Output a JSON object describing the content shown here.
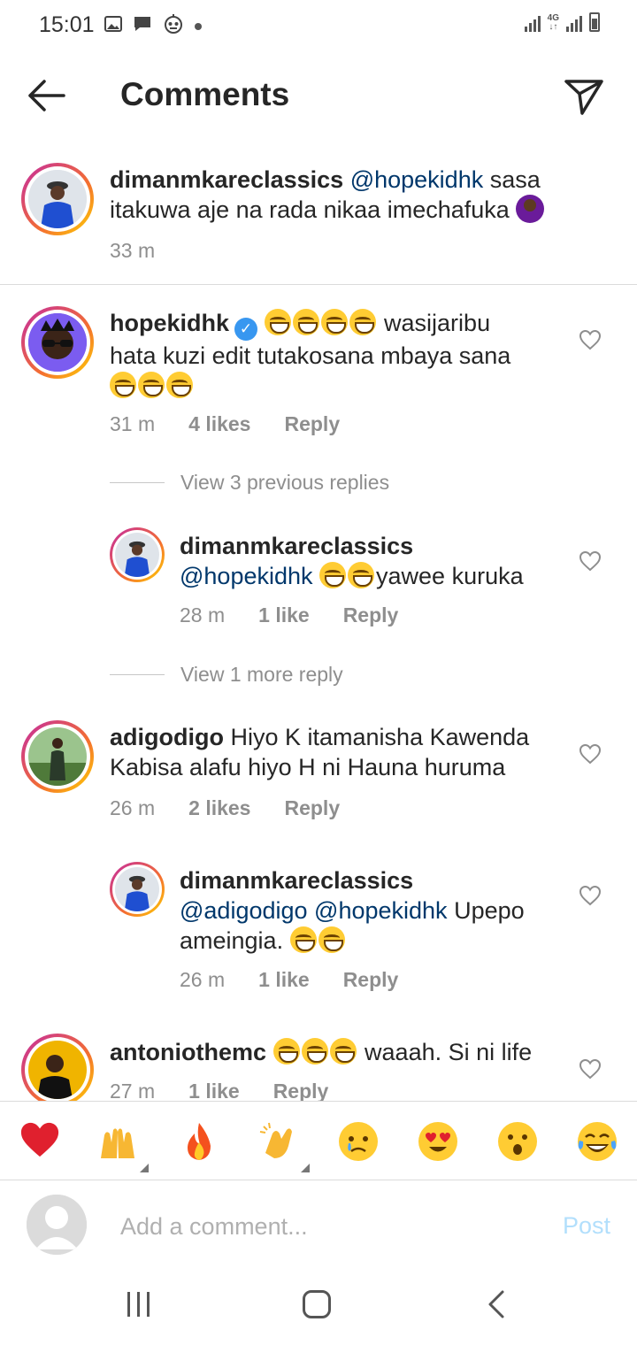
{
  "status_bar": {
    "time": "15:01",
    "icons": [
      "image-icon",
      "message-icon",
      "robot-icon",
      "dot-icon"
    ],
    "network": "4G"
  },
  "header": {
    "title": "Comments",
    "back_icon": "arrow-left-icon",
    "share_icon": "paper-plane-icon"
  },
  "comments": [
    {
      "user": "dimanmkareclassics",
      "line1_mention": "@hopekidhk",
      "line1_rest": "  sasa",
      "line2": "itakuwa aje na rada nikaa imechafuka",
      "time": "33 m"
    },
    {
      "user": "hopekidhk",
      "verified": true,
      "line1_rest": " wasijaribu",
      "line2": "hata kuzi edit tutakosana mbaya sana",
      "time": "31 m",
      "likes": "4 likes",
      "reply": "Reply"
    },
    {
      "view_replies": "View 3 previous replies"
    },
    {
      "user": "dimanmkareclassics",
      "line2_mention": "@hopekidhk",
      "line2_rest": "yawee kuruka",
      "time": "28 m",
      "likes": "1 like",
      "reply": "Reply"
    },
    {
      "view_replies": "View 1 more reply"
    },
    {
      "user": "adigodigo",
      "line1_rest": " Hiyo K itamanisha Kawenda",
      "line2": "Kabisa alafu hiyo H ni Hauna  huruma",
      "time": "26 m",
      "likes": "2 likes",
      "reply": "Reply"
    },
    {
      "user": "dimanmkareclassics",
      "line2_mention1": "@adigodigo",
      "line2_mention2": "@hopekidhk",
      "line2_rest": "  Upepo",
      "line3": "ameingia.",
      "time": "26 m",
      "likes": "1 like",
      "reply": "Reply"
    },
    {
      "user": "antoniothemc",
      "line1_rest": " waaah. Si ni life",
      "time": "27 m",
      "likes": "1 like",
      "reply": "Reply"
    }
  ],
  "reactions": [
    "❤️",
    "🙌",
    "🔥",
    "👏",
    "😢",
    "😍",
    "😮",
    "😂"
  ],
  "composer": {
    "placeholder": "Add a comment...",
    "post_label": "Post"
  }
}
